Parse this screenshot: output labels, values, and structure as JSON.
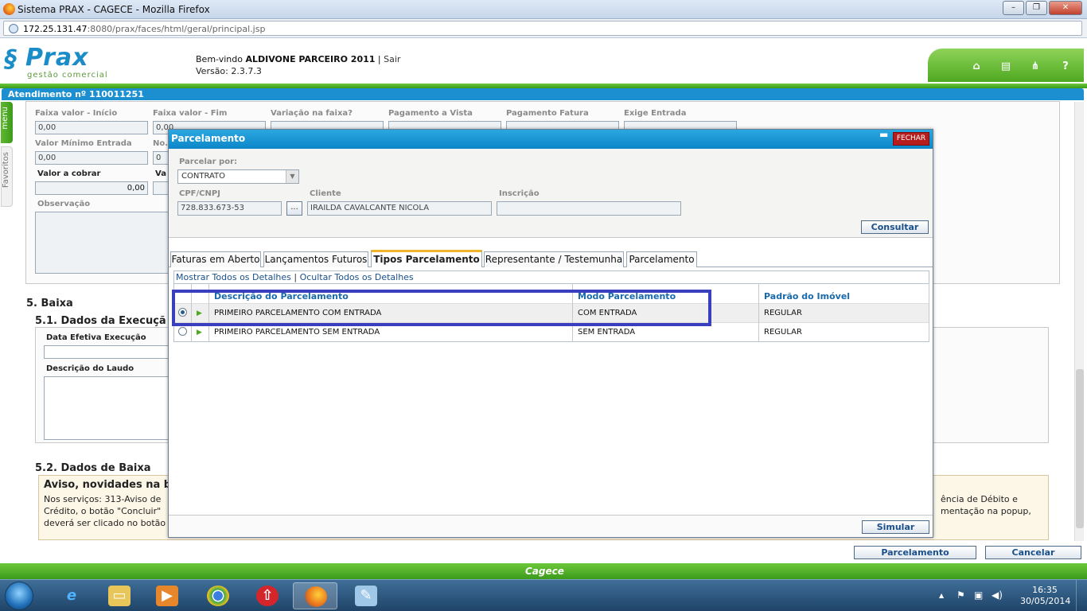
{
  "window": {
    "title": "Sistema PRAX - CAGECE - Mozilla Firefox",
    "url_host": "172.25.131.47",
    "url_rest": ":8080/prax/faces/html/geral/principal.jsp"
  },
  "header": {
    "logo_word": "Prax",
    "logo_sub": "gestão comercial",
    "welcome_prefix": "Bem-vindo",
    "user": "ALDIVONE PARCEIRO 2011",
    "separator": "|",
    "logout": "Sair",
    "version": "Versão: 2.3.7.3"
  },
  "atendimento": {
    "title": "Atendimento nº 110011251"
  },
  "side": {
    "menu": "menu",
    "favoritos": "Favoritos"
  },
  "bg_form": {
    "labels": {
      "faixa_inicio": "Faixa valor - Início",
      "faixa_fim": "Faixa valor - Fim",
      "variacao": "Variação na faixa?",
      "pag_vista": "Pagamento a Vista",
      "pag_fatura": "Pagamento Fatura",
      "exige_entrada": "Exige Entrada",
      "valor_minimo": "Valor Mínimo Entrada",
      "no_prefix": "No.",
      "valor_cobrar": "Valor a cobrar",
      "va_prefix": "Va",
      "observacao": "Observação"
    },
    "values": {
      "faixa_inicio": "0,00",
      "faixa_fim": "0,00",
      "valor_minimo": "0,00",
      "no_value": "0",
      "valor_cobrar": "0,00"
    },
    "sections": {
      "baixa": "5. Baixa",
      "dados_execucao": "5.1. Dados da Execuçã",
      "data_efetiva": "Data Efetiva Execução",
      "descricao_laudo": "Descrição do Laudo",
      "dados_baixa": "5.2. Dados de Baixa"
    },
    "notice": {
      "title": "Aviso, novidades na b",
      "line1_left": "Nos serviços: 313-Aviso de",
      "line1_right": "ência de Débito e",
      "line2_left": "Crédito, o botão \"Concluir\"",
      "line2_right": "mentação na popup,",
      "line3_left": "deverá ser clicado no botão"
    }
  },
  "bottom_actions": {
    "parcelamento": "Parcelamento",
    "cancelar": "Cancelar"
  },
  "footer": {
    "brand": "Cagece"
  },
  "modal": {
    "title": "Parcelamento",
    "close_label": "FECHAR",
    "parcelar_por_label": "Parcelar por:",
    "parcelar_por_value": "CONTRATO",
    "cpf_label": "CPF/CNPJ",
    "cpf_value": "728.833.673-53",
    "lookup_label": "...",
    "cliente_label": "Cliente",
    "cliente_value": "IRAILDA CAVALCANTE NICOLA",
    "inscricao_label": "Inscrição",
    "inscricao_value": "",
    "consultar": "Consultar",
    "tabs": [
      "Faturas em Aberto",
      "Lançamentos Futuros",
      "Tipos Parcelamento",
      "Representante / Testemunha",
      "Parcelamento"
    ],
    "detail_links": {
      "show": "Mostrar Todos os Detalhes",
      "sep": "|",
      "hide": "Ocultar Todos os Detalhes"
    },
    "grid": {
      "headers": [
        "Descrição do Parcelamento",
        "Modo Parcelamento",
        "Padrão do Imóvel"
      ],
      "rows": [
        {
          "descricao": "PRIMEIRO PARCELAMENTO COM ENTRADA",
          "modo": "COM ENTRADA",
          "padrao": "REGULAR",
          "selected": true
        },
        {
          "descricao": "PRIMEIRO PARCELAMENTO SEM ENTRADA",
          "modo": "SEM ENTRADA",
          "padrao": "REGULAR",
          "selected": false
        }
      ]
    },
    "simular": "Simular"
  },
  "taskbar": {
    "time": "16:35",
    "date": "30/05/2014"
  },
  "colors": {
    "brand_blue": "#1b8fd0",
    "brand_green": "#4ea820",
    "highlight": "#3a3fbd",
    "close_red": "#b81d1d"
  }
}
